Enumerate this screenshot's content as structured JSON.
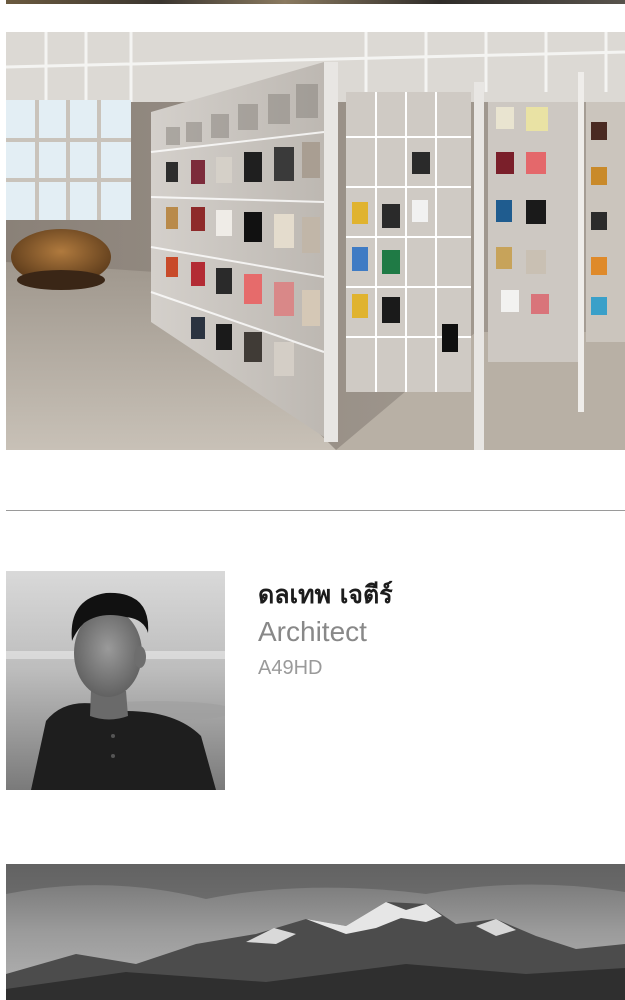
{
  "images": {
    "gallery": {
      "subject": "material-library-display-wall"
    },
    "portrait": {
      "subject": "person-portrait-grayscale"
    },
    "mountain": {
      "subject": "mountain-range-grayscale"
    }
  },
  "profile": {
    "name": "ดลเทพ เจตีร์",
    "role": "Architect",
    "company": "A49HD"
  }
}
